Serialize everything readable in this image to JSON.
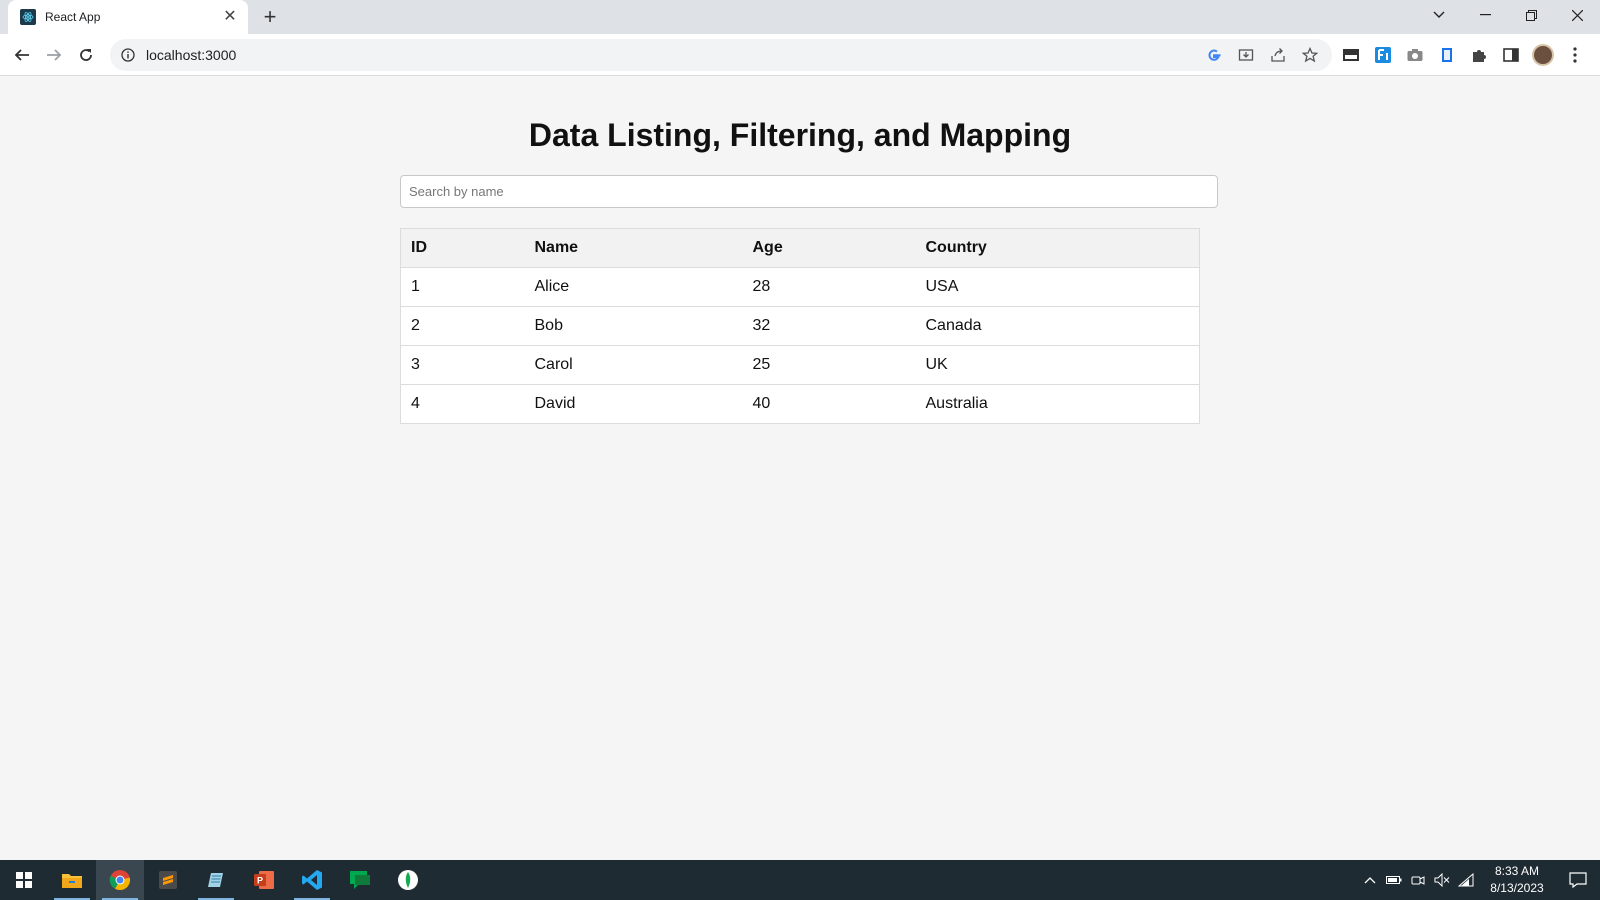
{
  "browser": {
    "tab_title": "React App",
    "new_tab_symbol": "+",
    "url": "localhost:3000"
  },
  "page": {
    "title": "Data Listing, Filtering, and Mapping",
    "search_placeholder": "Search by name",
    "search_value": "",
    "table": {
      "headers": [
        "ID",
        "Name",
        "Age",
        "Country"
      ],
      "rows": [
        [
          "1",
          "Alice",
          "28",
          "USA"
        ],
        [
          "2",
          "Bob",
          "32",
          "Canada"
        ],
        [
          "3",
          "Carol",
          "25",
          "UK"
        ],
        [
          "4",
          "David",
          "40",
          "Australia"
        ]
      ]
    }
  },
  "taskbar": {
    "apps": [
      "windows-start-icon",
      "file-explorer-icon",
      "chrome-icon",
      "sublime-text-icon",
      "notepad-icon",
      "powerpoint-icon",
      "vscode-icon",
      "chat-app-icon",
      "mongodb-compass-icon"
    ],
    "time": "8:33 AM",
    "date": "8/13/2023"
  }
}
